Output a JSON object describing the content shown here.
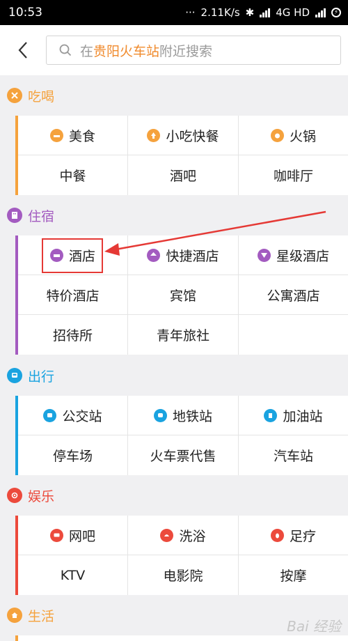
{
  "status": {
    "time": "10:53",
    "speed": "2.11K/s",
    "network": "4G HD"
  },
  "search": {
    "prefix": "在",
    "station": "贵阳火车站",
    "suffix": "附近搜索"
  },
  "sections": {
    "eat": {
      "title": "吃喝",
      "color": "#f5a23d",
      "rows": [
        [
          "美食",
          "小吃快餐",
          "火锅"
        ],
        [
          "中餐",
          "酒吧",
          "咖啡厅"
        ]
      ]
    },
    "stay": {
      "title": "住宿",
      "color": "#a35bc0",
      "rows": [
        [
          "酒店",
          "快捷酒店",
          "星级酒店"
        ],
        [
          "特价酒店",
          "宾馆",
          "公寓酒店"
        ],
        [
          "招待所",
          "青年旅社",
          ""
        ]
      ]
    },
    "travel": {
      "title": "出行",
      "color": "#1aa3e0",
      "rows": [
        [
          "公交站",
          "地铁站",
          "加油站"
        ],
        [
          "停车场",
          "火车票代售",
          "汽车站"
        ]
      ]
    },
    "fun": {
      "title": "娱乐",
      "color": "#ec4a3c",
      "rows": [
        [
          "网吧",
          "洗浴",
          "足疗"
        ],
        [
          "KTV",
          "电影院",
          "按摩"
        ]
      ]
    },
    "life": {
      "title": "生活",
      "color": "#f5a23d"
    }
  },
  "icons": {
    "eat": [
      "food-icon",
      "snack-icon",
      "hotpot-icon"
    ],
    "stay": [
      "hotel-icon",
      "budget-hotel-icon",
      "star-hotel-icon"
    ],
    "travel": [
      "bus-stop-icon",
      "subway-icon",
      "gas-station-icon"
    ],
    "fun": [
      "internet-cafe-icon",
      "bath-icon",
      "foot-massage-icon"
    ]
  },
  "watermark": "Bai 经验"
}
